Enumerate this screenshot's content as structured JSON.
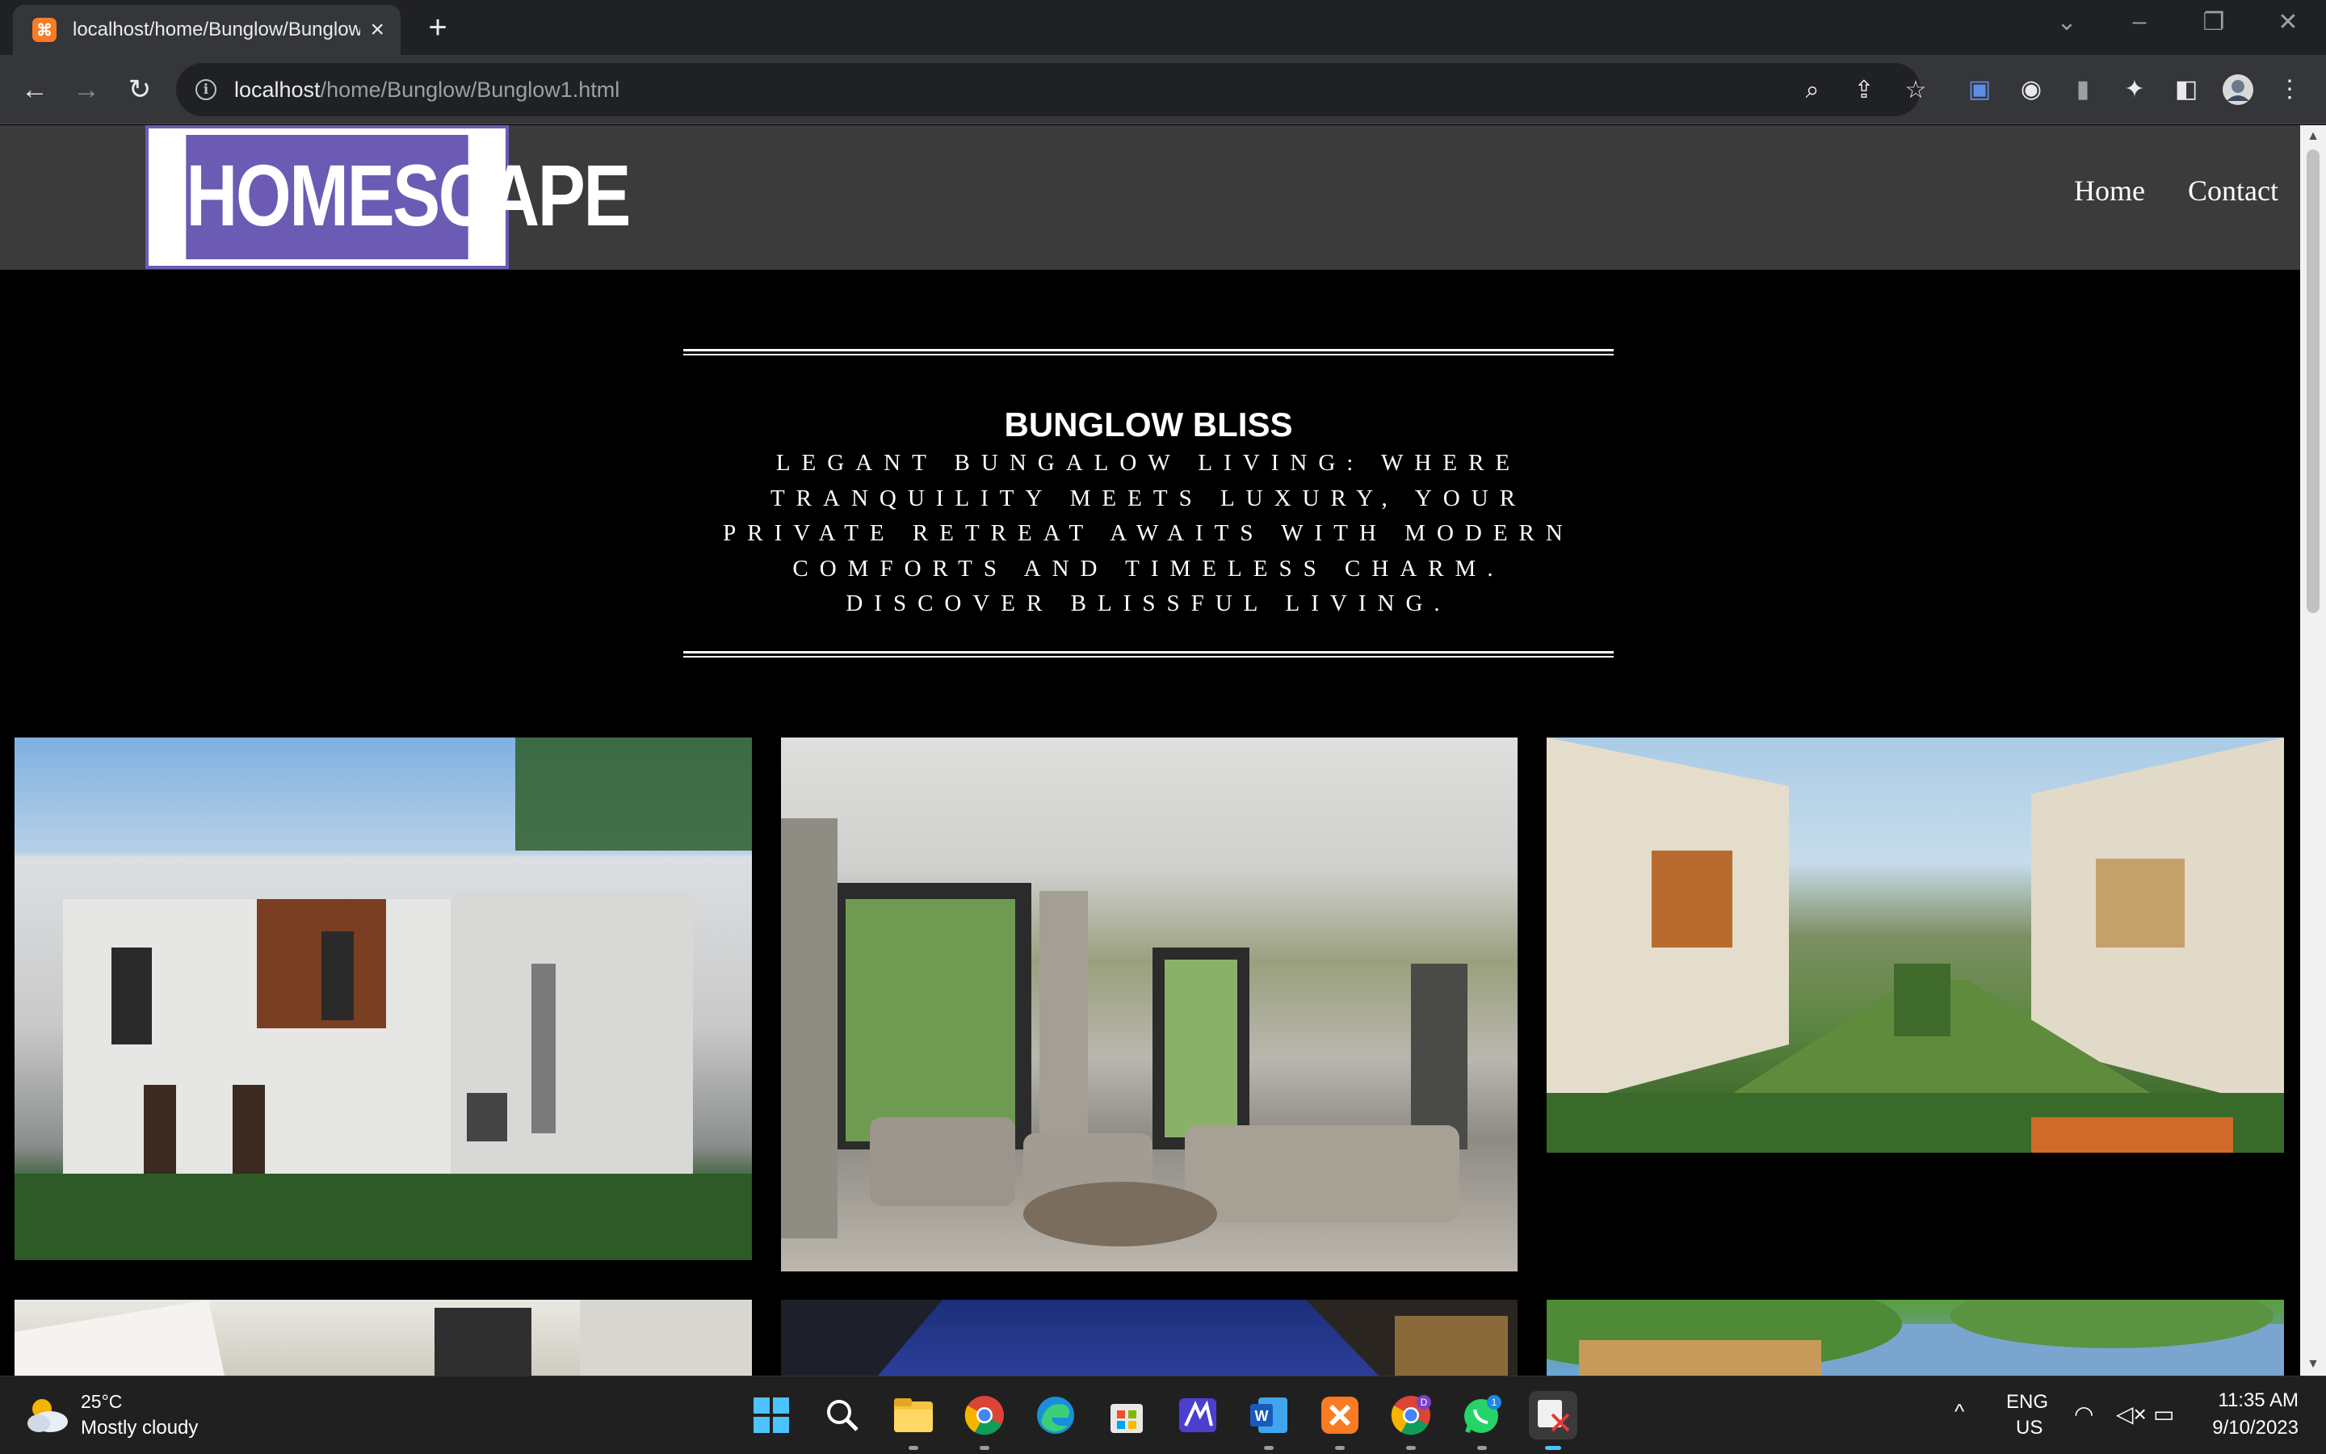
{
  "browser": {
    "tab_title": "localhost/home/Bunglow/Bunglow1.html",
    "tab_favicon": "XAMPP",
    "url_host": "localhost",
    "url_path": "/home/Bunglow/Bunglow1.html"
  },
  "site": {
    "logo_text": "HOMESCAPE",
    "nav": [
      "Home",
      "Contact"
    ],
    "hero_title": "BUNGLOW BLISS",
    "hero_text": "Legant bungalow living: where tranquility meets luxury, your private retreat awaits with modern comforts and timeless charm. Discover blissful living.",
    "gallery": [
      {
        "subject": "modern-bungalow-exterior"
      },
      {
        "subject": "living-room-interior"
      },
      {
        "subject": "bungalow-community-garden"
      },
      {
        "subject": "bungalow-facade"
      },
      {
        "subject": "bungalow-night-view"
      },
      {
        "subject": "bungalow-garden-trees"
      }
    ]
  },
  "taskbar": {
    "weather_temp": "25°C",
    "weather_condition": "Mostly cloudy",
    "lang_primary": "ENG",
    "lang_secondary": "US",
    "time": "11:35 AM",
    "date": "9/10/2023",
    "whatsapp_badge": "1",
    "chrome_profile_badge": "D"
  },
  "colors": {
    "logo_purple": "#6b5bb5",
    "header_bg": "#3b3b3b",
    "page_bg": "#000000"
  }
}
